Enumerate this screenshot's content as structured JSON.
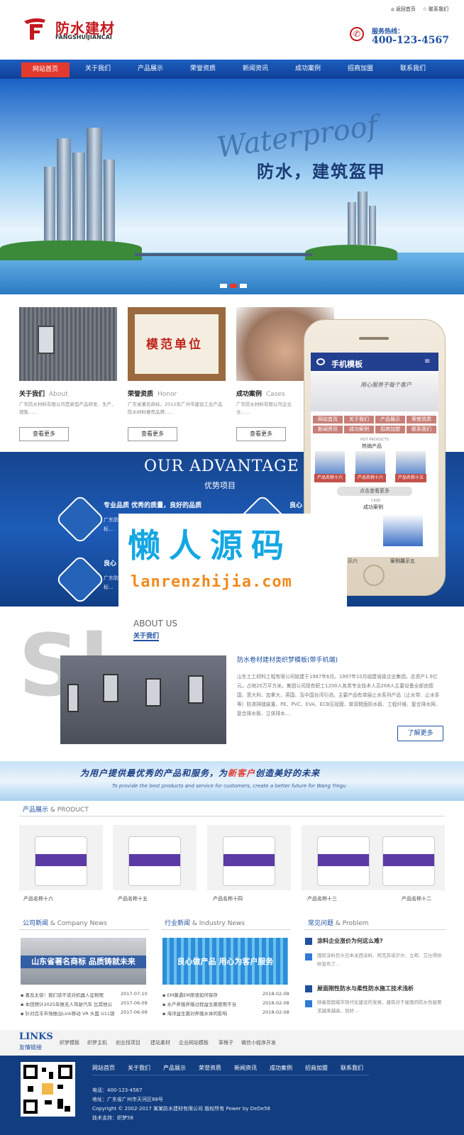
{
  "header": {
    "logo_cn": "防水建材",
    "logo_en": "FANGSHUIJIANCAI",
    "top_links": [
      "返回首页",
      "联系我们"
    ],
    "hotline_label": "服务热线：",
    "hotline_number": "400-123-4567"
  },
  "nav": [
    "网站首页",
    "关于我们",
    "产品展示",
    "荣誉资质",
    "新闻资讯",
    "成功案例",
    "招商加盟",
    "联系我们"
  ],
  "banner": {
    "script_text": "Waterproof",
    "slogan": "防水，建筑盔甲"
  },
  "cards": [
    {
      "title": "关于我们",
      "en": "About",
      "desc": "广东防水材料有限公司是新型产品研发、生产、销售……",
      "button": "查看更多"
    },
    {
      "title": "荣誉资质",
      "en": "Honor",
      "desc": "广东省著名商标，2012年广州市建设工业产品防水材料推荐品牌……",
      "button": "查看更多",
      "plaque": "模范单位"
    },
    {
      "title": "成功案例",
      "en": "Cases",
      "desc": "广东防水材料有限公司企业文……",
      "button": "查看更多"
    }
  ],
  "advantage": {
    "title": "OUR ADVANTAGE",
    "subtitle": "优势项目",
    "items": [
      {
        "head": "专业品质 优秀的质量，良好的品质",
        "text": "广东防……\n标…"
      },
      {
        "head": "良心",
        "text": "广东防……\n标…"
      }
    ],
    "right_head": "良心"
  },
  "phone": {
    "title": "手机模板",
    "banner_text": "用心服务于每个客户",
    "nav": [
      "网站首页",
      "关于我们",
      "产品展示",
      "荣誉资质",
      "新闻资讯",
      "成功案例",
      "招商加盟",
      "联系我们"
    ],
    "hot_label": "热销产品",
    "hot_label_en": "HOT PRODUCTS",
    "products": [
      "产品名称十六",
      "产品名称十六",
      "产品名称十五"
    ],
    "more": "点击查看更多",
    "case_label": "成功案例",
    "case_en": "CASE",
    "case_items": [
      "示六",
      "案例展示五"
    ]
  },
  "watermark": {
    "cn": "懒人源码",
    "en": "lanrenzhijia.com"
  },
  "about": {
    "big_letters": "Sl",
    "title_en": "ABOUT US",
    "title_cn": "关于我们",
    "head": "防水卷材建材类织梦模板(带手机端)",
    "text": "山东土工材料工程有限公司始建于1987年6月。1997年10月组建省级企业集团。总资产1.9亿元，占地20万平方米。集团公司现有职工1200人各类专业技术人员268人主要设备全部由德国、意大利、加拿大、英国、及中国台湾引进。主要产品有单层止水系列产品（止水带、止水条等）防渗排缝装置、PE、PVC、EVA、ECB压延膜、单双糙面防水板、工程纤维、复合排水网、复合排水板、立体排水...",
    "more": "了解更多"
  },
  "slogan": {
    "cn_before": "为用户提供最优秀的产品和服务，为",
    "cn_highlight": "新客户",
    "cn_after": "创造美好的未来",
    "en": "To provide the best products and service for customers, create a better future for Wang Yingu"
  },
  "products": {
    "title": "产品展示",
    "title_en": "& PRODUCT",
    "items": [
      "产品名称十六",
      "产品名称十五",
      "产品名称十四",
      "产品名称十三",
      "产品名称十二"
    ]
  },
  "company_news": {
    "title": "公司新闻",
    "title_en": "& Company News",
    "image_text": "山东省著名商标  品质铸就未来",
    "items": [
      {
        "text": "喜及太侠！我们该不该对机器人征税呢",
        "date": "2017-07-10"
      },
      {
        "text": "本田预计2025年推无人驾驶汽车 比其他公",
        "date": "2017-06-09"
      },
      {
        "text": "针对吕丰市场推出Link移动 VR 头盔 U11锁",
        "date": "2017-06-09"
      }
    ]
  },
  "industry_news": {
    "title": "行业新闻",
    "title_en": "& Industry News",
    "image_text": "良心做产品  用心为客户服务",
    "items": [
      {
        "text": "EM菌遇EM原液如何保存",
        "date": "2018-02-08"
      },
      {
        "text": "水产养殖养殖过程益生菌使用不当",
        "date": "2018-02-08"
      },
      {
        "text": "海洋益生菌对养殖水体的影响",
        "date": "2018-02-08"
      }
    ]
  },
  "faq": {
    "title": "常见问题",
    "title_en": "& Problem",
    "items": [
      {
        "q": "涂料企业涨价为何这么难?",
        "a": "国际涂料巨头日本关西涂料、阿克苏诺贝尔、立邦、艾仕得纷纷宣布了..."
      },
      {
        "q": "屋面刚性防水与柔性防水施工技术浅析",
        "a": "随着我国城市现代化建设的发展，建筑对于屋面的防水性能要求越来越高，良好..."
      }
    ]
  },
  "links": {
    "en": "LINKS",
    "cn": "友情链接",
    "items": [
      "织梦模板",
      "织梦主机",
      "创业找项目",
      "建站素材",
      "企业网站模板",
      "草根子",
      "微信小程序开发"
    ]
  },
  "footer": {
    "nav": [
      "网站首页",
      "关于我们",
      "产品展示",
      "荣誉资质",
      "新闻资讯",
      "成功案例",
      "招商加盟",
      "联系我们"
    ],
    "phone": "电话：400-123-4567",
    "address": "地址：广东省广州市天河区88号",
    "copyright": "Copyright © 2002-2017 某某防水建材有限公司 版权所有 Power by DeDe58",
    "support": "技术支持：织梦58"
  },
  "colors": {
    "brand_blue": "#1e50a2",
    "accent_red": "#e23a2f",
    "footer_blue": "#123d80"
  }
}
